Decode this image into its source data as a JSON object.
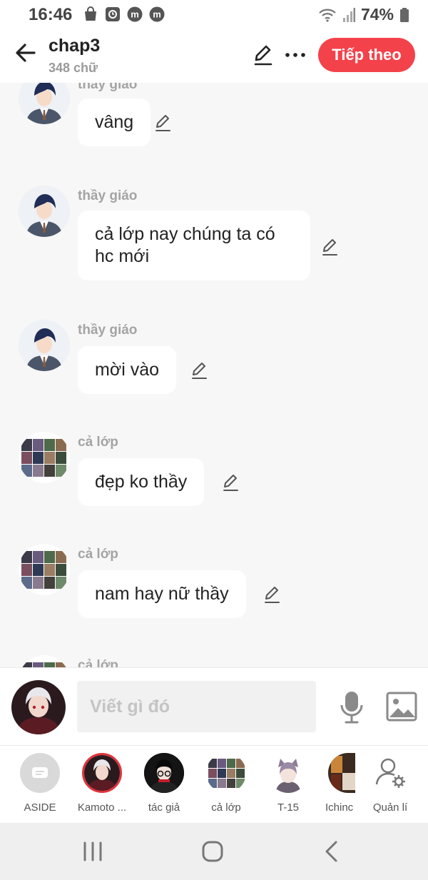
{
  "status_bar": {
    "time": "16:46",
    "battery": "74%",
    "left_icons": [
      "bag-icon",
      "clock-app-icon",
      "m-app-icon",
      "m-app-icon"
    ],
    "right_icons": [
      "wifi-icon",
      "signal-icon",
      "battery-icon"
    ]
  },
  "header": {
    "title": "chap3",
    "subtitle": "348 chữ",
    "next_label": "Tiếp theo",
    "accent_color": "#f4424b"
  },
  "messages": [
    {
      "sender": "thầy giáo",
      "text": "vâng",
      "avatar": "teacher"
    },
    {
      "sender": "thầy giáo",
      "text": "cả lớp nay chúng ta có hc mới",
      "avatar": "teacher"
    },
    {
      "sender": "thầy giáo",
      "text": "mời vào",
      "avatar": "teacher"
    },
    {
      "sender": "cả lớp",
      "text": "đẹp ko thầy",
      "avatar": "class"
    },
    {
      "sender": "cả lớp",
      "text": "nam hay nữ thầy",
      "avatar": "class"
    },
    {
      "sender": "cả lớp",
      "text": "",
      "avatar": "class"
    }
  ],
  "composer": {
    "placeholder": "Viết gì đó"
  },
  "characters": [
    {
      "label": "ASIDE",
      "avatar": "aside"
    },
    {
      "label": "Kamoto ...",
      "avatar": "kamoto"
    },
    {
      "label": "tác giả",
      "avatar": "author"
    },
    {
      "label": "cả lớp",
      "avatar": "class"
    },
    {
      "label": "T-15",
      "avatar": "t15"
    },
    {
      "label": "Ichinc",
      "avatar": "ichinc"
    },
    {
      "label": "Quản lí",
      "avatar": "manage"
    }
  ]
}
